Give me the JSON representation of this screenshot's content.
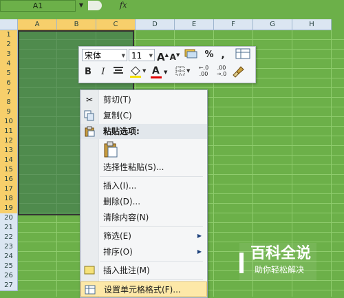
{
  "formula_bar": {
    "name_box": "A1",
    "fx": "fx",
    "formula": ""
  },
  "columns": [
    {
      "label": "A",
      "selected": true
    },
    {
      "label": "B",
      "selected": true
    },
    {
      "label": "C",
      "selected": true
    },
    {
      "label": "D",
      "selected": false
    },
    {
      "label": "E",
      "selected": false
    },
    {
      "label": "F",
      "selected": false
    },
    {
      "label": "G",
      "selected": false
    },
    {
      "label": "H",
      "selected": false
    }
  ],
  "rows": [
    "1",
    "2",
    "3",
    "4",
    "5",
    "6",
    "7",
    "8",
    "9",
    "10",
    "11",
    "12",
    "13",
    "14",
    "15",
    "16",
    "17",
    "18",
    "19",
    "20",
    "21",
    "22",
    "23",
    "24",
    "25",
    "26",
    "27"
  ],
  "selected_rows": 19,
  "mini_toolbar": {
    "font_name": "宋体",
    "font_size": "11",
    "bold": "B",
    "italic": "I",
    "grow_font": "A",
    "shrink_font": "A",
    "percent": "%",
    "comma": ",",
    "font_color": "A",
    "inc_decimal": "←.0\n.00",
    "dec_decimal": ".00\n→.0"
  },
  "context_menu": {
    "items": [
      {
        "label": "剪切(T)",
        "icon": "scissors-icon"
      },
      {
        "label": "复制(C)",
        "icon": "copy-icon"
      },
      {
        "label": "粘贴选项:",
        "icon": "paste-icon",
        "header": true
      },
      {
        "label": "选择性粘贴(S)..."
      },
      {
        "label": "插入(I)..."
      },
      {
        "label": "删除(D)..."
      },
      {
        "label": "清除内容(N)"
      },
      {
        "label": "筛选(E)",
        "submenu": true
      },
      {
        "label": "排序(O)",
        "submenu": true
      },
      {
        "label": "插入批注(M)",
        "icon": "comment-icon"
      },
      {
        "label": "设置单元格格式(F)...",
        "icon": "format-cells-icon",
        "highlighted": true
      }
    ]
  },
  "watermark": {
    "title": "百科全说",
    "subtitle": "助你轻松解决"
  },
  "colors": {
    "sheet_bg": "#6cb049",
    "header_sel": "#f7cf6b",
    "menu_highlight": "#fde8a8"
  }
}
